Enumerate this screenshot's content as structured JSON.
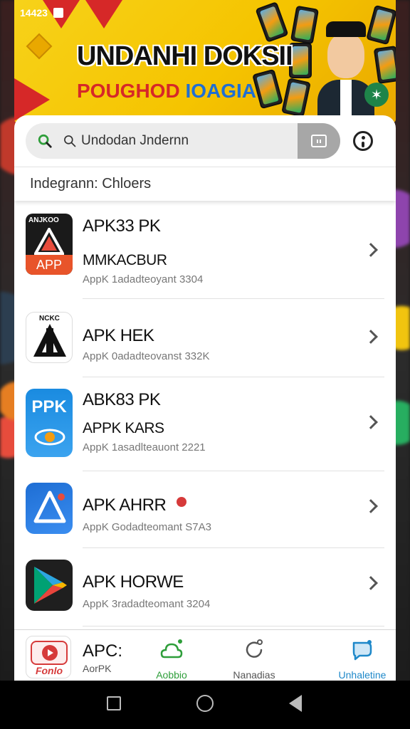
{
  "status": {
    "time": "14423"
  },
  "banner": {
    "title_line1": "UNDANHI DOKSII",
    "title_line2_a": "POUGHOD",
    "title_line2_b": "IOAGIA"
  },
  "search": {
    "value": "Undodan Jndernn"
  },
  "category": {
    "label": "Indegrann: Chloers"
  },
  "apps": [
    {
      "icon_label": "APP",
      "icon_top": "ANJKOO",
      "title": "APK33 PK",
      "subtitle": "MMKACBUR",
      "meta": "AppK 1adadteoyant 3304"
    },
    {
      "icon_label": "",
      "icon_top": "NCKC",
      "title": "APK HEK",
      "subtitle": "",
      "meta": "AppK 0adadteovanst 332K"
    },
    {
      "icon_label": "PPK",
      "icon_top": "",
      "title": "ABK83 PK",
      "subtitle": "APPK KARS",
      "meta": "AppK 1asadlteauont 2221"
    },
    {
      "icon_label": "",
      "icon_top": "",
      "title": "APK AHRR",
      "subtitle": "",
      "meta": "AppK Godadteomant S7A3"
    },
    {
      "icon_label": "",
      "icon_top": "",
      "title": "APK HORWE",
      "subtitle": "",
      "meta": "AppK 3radadteomant 3204"
    }
  ],
  "bottom": {
    "app_title": "APC:",
    "app_sub": "AorPK",
    "app_icon_text": "Fonlo",
    "nav": [
      {
        "label": "Aobbio",
        "icon": "cloud-icon",
        "color": "#2e9e3a"
      },
      {
        "label": "Nanadias",
        "icon": "refresh-icon",
        "color": "#555555"
      },
      {
        "label": "Unhaletine",
        "icon": "chat-icon",
        "color": "#1e88c9"
      }
    ]
  }
}
